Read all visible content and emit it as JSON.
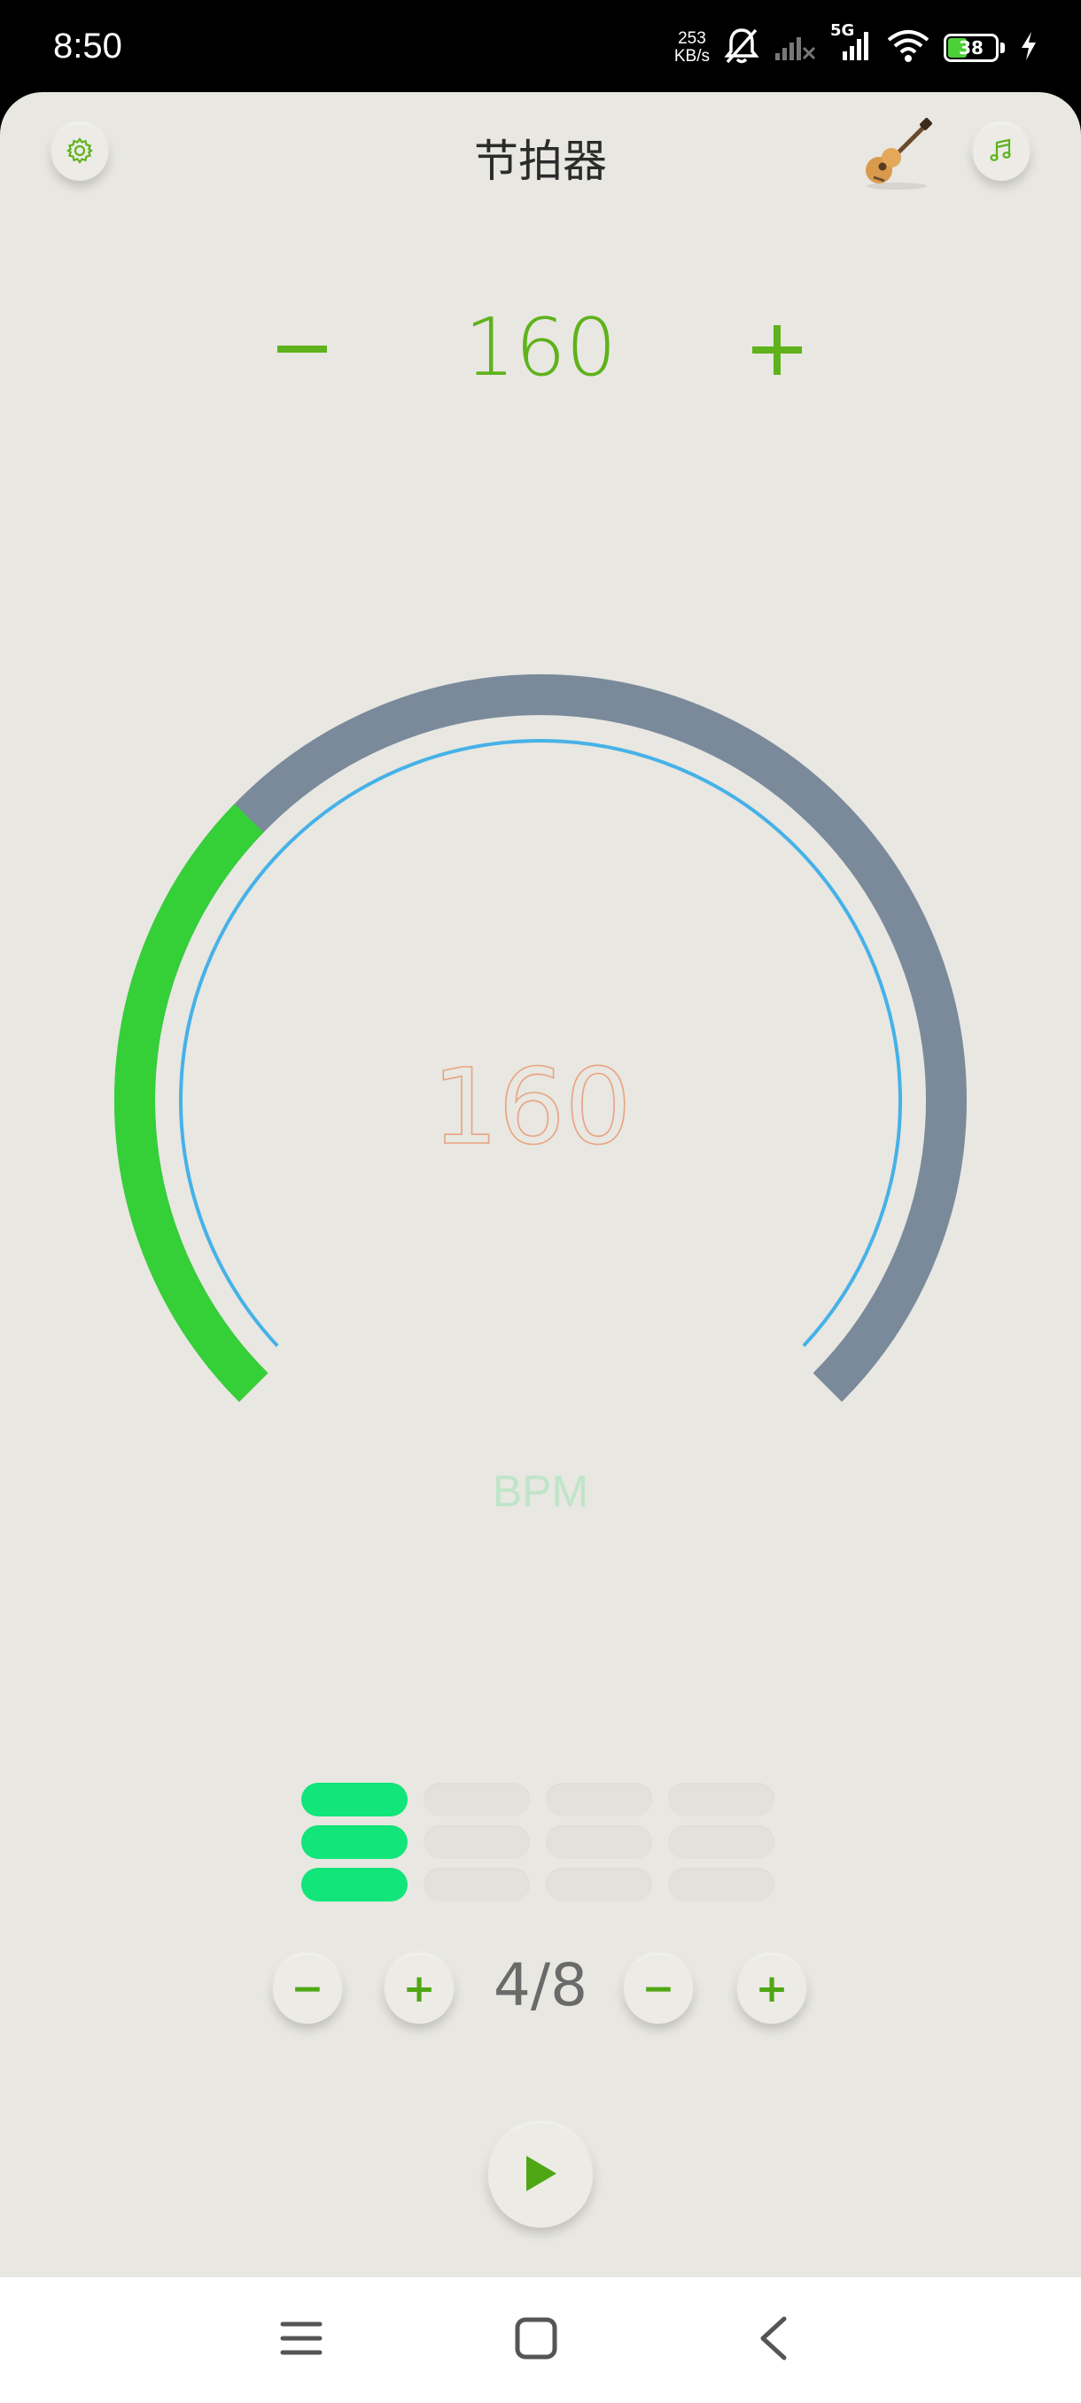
{
  "status_bar": {
    "time": "8:50",
    "network_speed_value": "253",
    "network_speed_unit": "KB/s",
    "network_type": "5G",
    "battery_level": "38",
    "icons": [
      "bell-off-icon",
      "signal-no-sim-icon",
      "signal-5g-icon",
      "wifi-icon",
      "battery-icon",
      "charging-icon"
    ]
  },
  "header": {
    "title": "节拍器",
    "settings_icon": "gear-icon",
    "guitar_icon": "guitar-icon",
    "music_icon": "music-note-icon"
  },
  "tempo": {
    "value": "160",
    "decrease_label": "−",
    "increase_label": "+"
  },
  "dial": {
    "center_value": "160",
    "unit_label": "BPM",
    "progress_fraction": 0.33,
    "colors": {
      "progress": "#35cf38",
      "track": "#7a8a9b",
      "inner_ring": "#46b1e8",
      "value": "#e9a382"
    }
  },
  "beat_grid": {
    "columns": 4,
    "rows": 3,
    "active_columns": [
      0
    ],
    "colors": {
      "active": "#12e67a",
      "inactive": "#e2e1db"
    }
  },
  "time_signature": {
    "value": "4/8",
    "beats_minus": "−",
    "beats_plus": "+",
    "note_minus": "−",
    "note_plus": "+"
  },
  "transport": {
    "play_icon": "play-icon"
  },
  "nav_bar": {
    "items": [
      "menu-icon",
      "home-icon",
      "back-icon"
    ]
  },
  "colors": {
    "accent": "#5fb21b",
    "background": "#e8e7e1"
  }
}
